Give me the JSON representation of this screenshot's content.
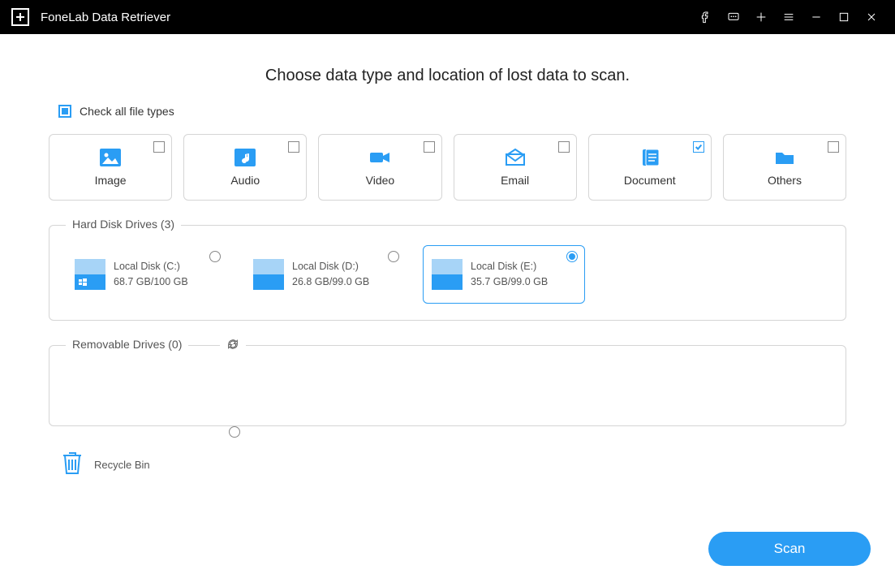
{
  "app_title": "FoneLab Data Retriever",
  "headline": "Choose data type and location of lost data to scan.",
  "check_all_label": "Check all file types",
  "check_all_state": "indeterminate",
  "types": [
    {
      "label": "Image",
      "checked": false
    },
    {
      "label": "Audio",
      "checked": false
    },
    {
      "label": "Video",
      "checked": false
    },
    {
      "label": "Email",
      "checked": false
    },
    {
      "label": "Document",
      "checked": true
    },
    {
      "label": "Others",
      "checked": false
    }
  ],
  "hard_disk_section_label": "Hard Disk Drives (3)",
  "drives": [
    {
      "name": "Local Disk (C:)",
      "size": "68.7 GB/100 GB",
      "is_system": true,
      "selected": false
    },
    {
      "name": "Local Disk (D:)",
      "size": "26.8 GB/99.0 GB",
      "is_system": false,
      "selected": false
    },
    {
      "name": "Local Disk (E:)",
      "size": "35.7 GB/99.0 GB",
      "is_system": false,
      "selected": true
    }
  ],
  "removable_section_label": "Removable Drives (0)",
  "recycle_bin_label": "Recycle Bin",
  "scan_button_label": "Scan",
  "colors": {
    "accent": "#2a9df4"
  }
}
